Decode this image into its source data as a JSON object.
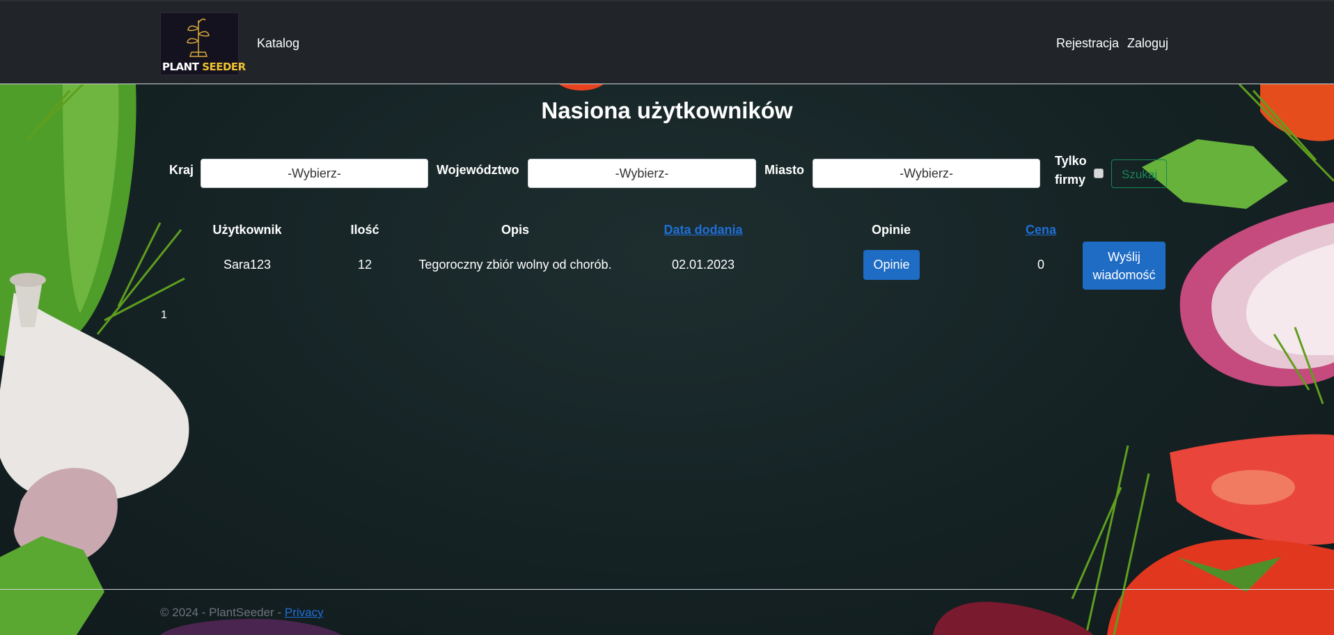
{
  "navbar": {
    "logo_text_1": "PLANT",
    "logo_text_2": "SEEDER",
    "catalog": "Katalog",
    "register": "Rejestracja",
    "login": "Zaloguj"
  },
  "page": {
    "title": "Nasiona użytkowników"
  },
  "filters": {
    "country_label": "Kraj",
    "country_value": "-Wybierz-",
    "province_label": "Województwo",
    "province_value": "-Wybierz-",
    "city_label": "Miasto",
    "city_value": "-Wybierz-",
    "companies_only_label_1": "Tylko",
    "companies_only_label_2": "firmy",
    "search_button": "Szukaj"
  },
  "table": {
    "headers": {
      "user": "Użytkownik",
      "quantity": "Ilość",
      "description": "Opis",
      "date_added": "Data dodania",
      "reviews": "Opinie",
      "price": "Cena"
    },
    "rows": [
      {
        "user": "Sara123",
        "quantity": "12",
        "description": "Tegoroczny zbiór wolny od chorób.",
        "date_added": "02.01.2023",
        "reviews_button": "Opinie",
        "price": "0",
        "message_button_1": "Wyślij",
        "message_button_2": "wiadomość"
      }
    ]
  },
  "pagination": {
    "current_page": "1"
  },
  "footer": {
    "copyright": "© 2024 - PlantSeeder - ",
    "privacy": "Privacy"
  },
  "colors": {
    "navbar": "#212529",
    "primary": "#1f6cc5",
    "success": "#198754",
    "link": "#1f6fd8"
  }
}
